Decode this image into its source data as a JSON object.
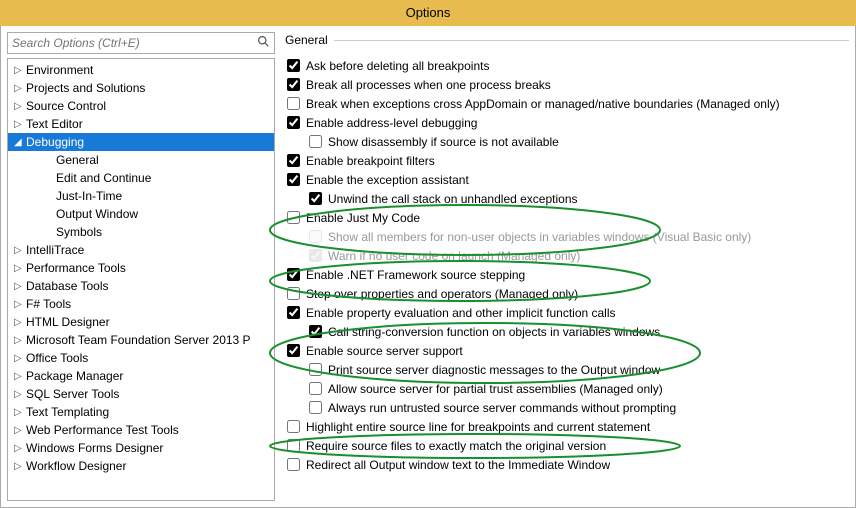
{
  "window": {
    "title": "Options"
  },
  "search": {
    "placeholder": "Search Options (Ctrl+E)"
  },
  "section": {
    "header": "General"
  },
  "tree": {
    "items": [
      {
        "label": "Environment",
        "glyph": "▷",
        "selected": false,
        "child": false
      },
      {
        "label": "Projects and Solutions",
        "glyph": "▷",
        "selected": false,
        "child": false
      },
      {
        "label": "Source Control",
        "glyph": "▷",
        "selected": false,
        "child": false
      },
      {
        "label": "Text Editor",
        "glyph": "▷",
        "selected": false,
        "child": false
      },
      {
        "label": "Debugging",
        "glyph": "◢",
        "selected": true,
        "child": false
      },
      {
        "label": "General",
        "glyph": "",
        "selected": false,
        "child": true
      },
      {
        "label": "Edit and Continue",
        "glyph": "",
        "selected": false,
        "child": true
      },
      {
        "label": "Just-In-Time",
        "glyph": "",
        "selected": false,
        "child": true
      },
      {
        "label": "Output Window",
        "glyph": "",
        "selected": false,
        "child": true
      },
      {
        "label": "Symbols",
        "glyph": "",
        "selected": false,
        "child": true
      },
      {
        "label": "IntelliTrace",
        "glyph": "▷",
        "selected": false,
        "child": false
      },
      {
        "label": "Performance Tools",
        "glyph": "▷",
        "selected": false,
        "child": false
      },
      {
        "label": "Database Tools",
        "glyph": "▷",
        "selected": false,
        "child": false
      },
      {
        "label": "F# Tools",
        "glyph": "▷",
        "selected": false,
        "child": false
      },
      {
        "label": "HTML Designer",
        "glyph": "▷",
        "selected": false,
        "child": false
      },
      {
        "label": "Microsoft Team Foundation Server 2013 P",
        "glyph": "▷",
        "selected": false,
        "child": false
      },
      {
        "label": "Office Tools",
        "glyph": "▷",
        "selected": false,
        "child": false
      },
      {
        "label": "Package Manager",
        "glyph": "▷",
        "selected": false,
        "child": false
      },
      {
        "label": "SQL Server Tools",
        "glyph": "▷",
        "selected": false,
        "child": false
      },
      {
        "label": "Text Templating",
        "glyph": "▷",
        "selected": false,
        "child": false
      },
      {
        "label": "Web Performance Test Tools",
        "glyph": "▷",
        "selected": false,
        "child": false
      },
      {
        "label": "Windows Forms Designer",
        "glyph": "▷",
        "selected": false,
        "child": false
      },
      {
        "label": "Workflow Designer",
        "glyph": "▷",
        "selected": false,
        "child": false
      }
    ]
  },
  "options": [
    {
      "label": "Ask before deleting all breakpoints",
      "checked": true,
      "indent": 1,
      "disabled": false
    },
    {
      "label": "Break all processes when one process breaks",
      "checked": true,
      "indent": 1,
      "disabled": false
    },
    {
      "label": "Break when exceptions cross AppDomain or managed/native boundaries (Managed only)",
      "checked": false,
      "indent": 1,
      "disabled": false
    },
    {
      "label": "Enable address-level debugging",
      "checked": true,
      "indent": 1,
      "disabled": false
    },
    {
      "label": "Show disassembly if source is not available",
      "checked": false,
      "indent": 2,
      "disabled": false
    },
    {
      "label": "Enable breakpoint filters",
      "checked": true,
      "indent": 1,
      "disabled": false
    },
    {
      "label": "Enable the exception assistant",
      "checked": true,
      "indent": 1,
      "disabled": false
    },
    {
      "label": "Unwind the call stack on unhandled exceptions",
      "checked": true,
      "indent": 2,
      "disabled": false
    },
    {
      "label": "Enable Just My Code",
      "checked": false,
      "indent": 1,
      "disabled": false
    },
    {
      "label": "Show all members for non-user objects in variables windows (Visual Basic only)",
      "checked": false,
      "indent": 2,
      "disabled": true
    },
    {
      "label": "Warn if no user code on launch (Managed only)",
      "checked": true,
      "indent": 2,
      "disabled": true
    },
    {
      "label": "Enable .NET Framework source stepping",
      "checked": true,
      "indent": 1,
      "disabled": false
    },
    {
      "label": "Step over properties and operators (Managed only)",
      "checked": false,
      "indent": 1,
      "disabled": false
    },
    {
      "label": "Enable property evaluation and other implicit function calls",
      "checked": true,
      "indent": 1,
      "disabled": false
    },
    {
      "label": "Call string-conversion function on objects in variables windows",
      "checked": true,
      "indent": 2,
      "disabled": false
    },
    {
      "label": "Enable source server support",
      "checked": true,
      "indent": 1,
      "disabled": false
    },
    {
      "label": "Print source server diagnostic messages to the Output window",
      "checked": false,
      "indent": 2,
      "disabled": false
    },
    {
      "label": "Allow source server for partial trust assemblies (Managed only)",
      "checked": false,
      "indent": 2,
      "disabled": false
    },
    {
      "label": "Always run untrusted source server commands without prompting",
      "checked": false,
      "indent": 2,
      "disabled": false
    },
    {
      "label": "Highlight entire source line for breakpoints and current statement",
      "checked": false,
      "indent": 1,
      "disabled": false
    },
    {
      "label": "Require source files to exactly match the original version",
      "checked": false,
      "indent": 1,
      "disabled": false
    },
    {
      "label": "Redirect all Output window text to the Immediate Window",
      "checked": false,
      "indent": 1,
      "disabled": false
    }
  ],
  "annotations": {
    "stroke": "#1a8f2e"
  }
}
